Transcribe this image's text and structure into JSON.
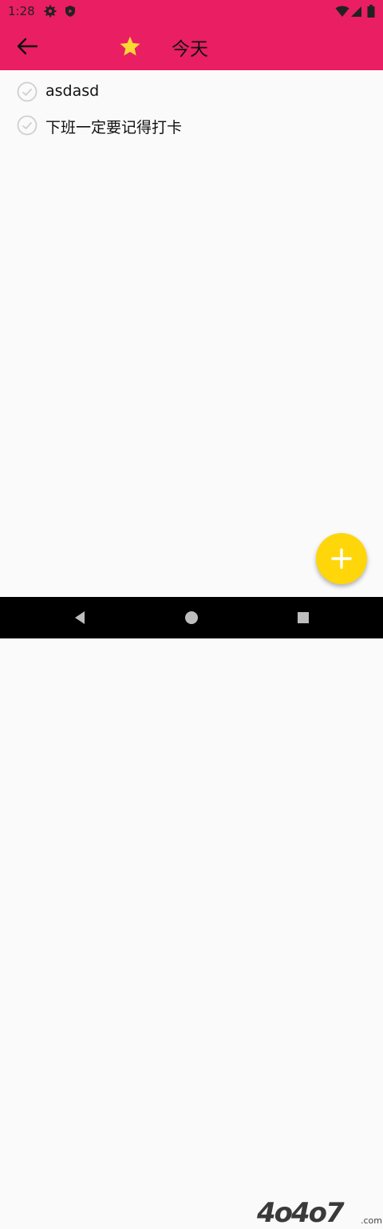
{
  "status_bar": {
    "time": "1:28",
    "icons": [
      "gear-icon",
      "shield-icon",
      "wifi-icon",
      "signal-icon",
      "battery-icon"
    ]
  },
  "app_bar": {
    "back_icon": "arrow-left-icon",
    "star_icon": "star-icon",
    "title": "今天",
    "color": "#e91e63",
    "star_color": "#fdd835"
  },
  "tasks": [
    {
      "text": "asdasd",
      "icon": "check-circle-icon"
    },
    {
      "text": "下班一定要记得打卡",
      "icon": "check-circle-icon"
    }
  ],
  "fab": {
    "icon": "plus-icon",
    "color": "#ffd60a"
  },
  "nav_bar": {
    "icons": [
      "back-triangle-icon",
      "home-circle-icon",
      "recents-square-icon"
    ]
  },
  "watermark": {
    "text": "4o4o7",
    "suffix": ".com"
  }
}
